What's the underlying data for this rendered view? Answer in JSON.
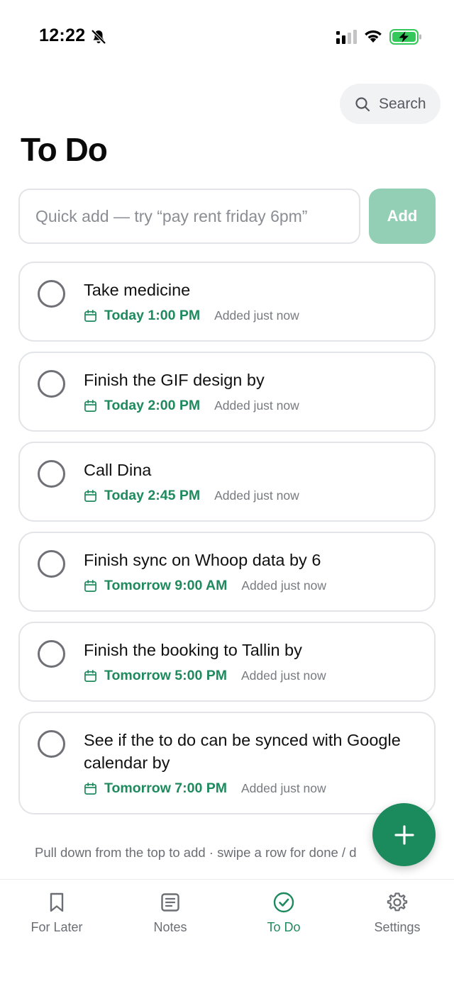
{
  "status_bar": {
    "time": "12:22",
    "colors": {
      "battery_fill": "#34c759"
    }
  },
  "search": {
    "label": "Search",
    "icon": "search-icon"
  },
  "page": {
    "title": "To Do"
  },
  "quick_add": {
    "placeholder": "Quick add — try “pay rent friday 6pm”",
    "value": "",
    "button_label": "Add"
  },
  "tasks": [
    {
      "title": "Take medicine",
      "due": "Today 1:00 PM",
      "added": "Added just now",
      "done": false
    },
    {
      "title": "Finish the GIF design by",
      "due": "Today 2:00 PM",
      "added": "Added just now",
      "done": false
    },
    {
      "title": "Call Dina",
      "due": "Today 2:45 PM",
      "added": "Added just now",
      "done": false
    },
    {
      "title": "Finish sync on Whoop data by 6",
      "due": "Tomorrow 9:00 AM",
      "added": "Added just now",
      "done": false
    },
    {
      "title": "Finish the booking to Tallin by",
      "due": "Tomorrow 5:00 PM",
      "added": "Added just now",
      "done": false
    },
    {
      "title": "See if the to do can be synced with Google calendar by",
      "due": "Tomorrow 7:00 PM",
      "added": "Added just now",
      "done": false
    }
  ],
  "hint": "Pull down from the top to add · swipe a row for done / d",
  "fab": {
    "icon": "plus-icon"
  },
  "tabs": [
    {
      "label": "For Later",
      "icon": "bookmark-icon",
      "active": false
    },
    {
      "label": "Notes",
      "icon": "notes-icon",
      "active": false
    },
    {
      "label": "To Do",
      "icon": "check-circle-icon",
      "active": true
    },
    {
      "label": "Settings",
      "icon": "gear-icon",
      "active": false
    }
  ],
  "colors": {
    "accent": "#1f8a5e",
    "fab": "#1b8a5c",
    "add_button": "#92cfb5",
    "border": "#e3e4e7",
    "search_bg": "#f1f2f4"
  }
}
